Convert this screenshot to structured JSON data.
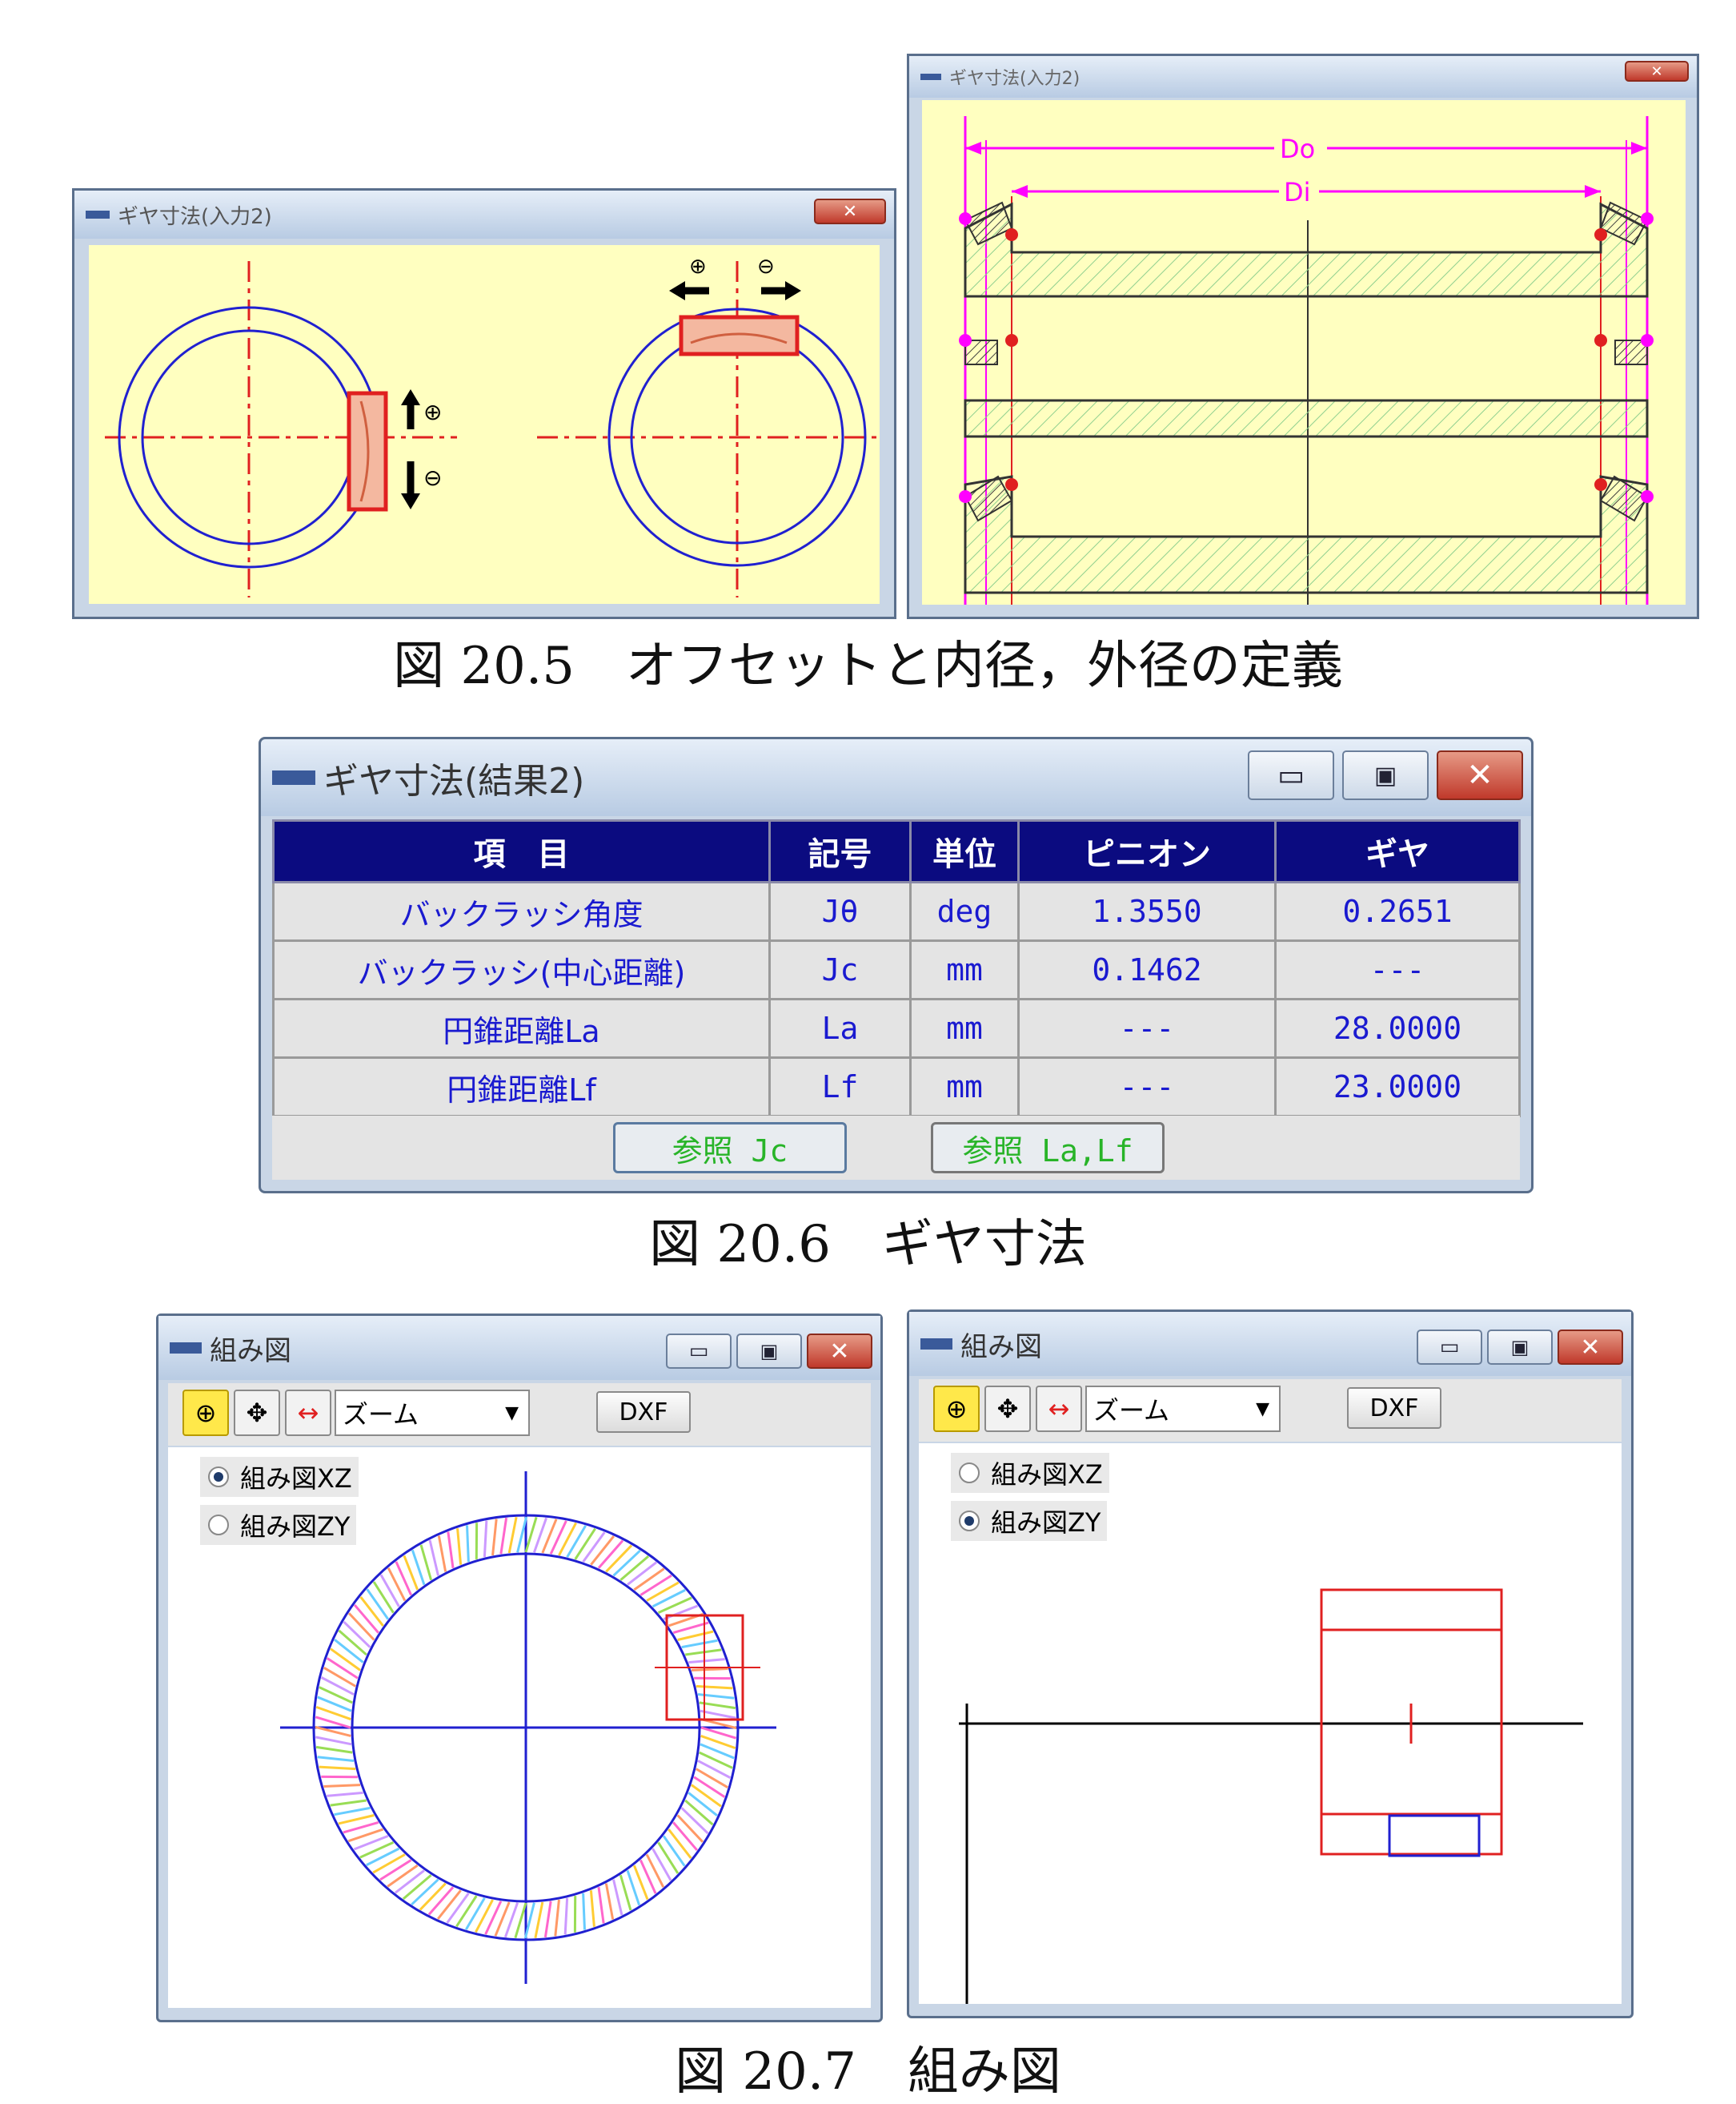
{
  "fig205": {
    "left_window_title": "ギヤ寸法(入力2)",
    "right_window_title": "ギヤ寸法(入力2)",
    "symbol_plus": "⊕",
    "symbol_minus": "⊖",
    "label_do": "Do",
    "label_di": "Di",
    "caption": "図 20.5　オフセットと内径，外径の定義"
  },
  "fig206": {
    "window_title": "ギヤ寸法(結果2)",
    "columns": [
      "項　目",
      "記号",
      "単位",
      "ピニオン",
      "ギヤ"
    ],
    "rows": [
      [
        "バックラッシ角度",
        "Jθ",
        "deg",
        "1.3550",
        "0.2651"
      ],
      [
        "バックラッシ(中心距離)",
        "Jc",
        "mm",
        "0.1462",
        "---"
      ],
      [
        "円錐距離La",
        "La",
        "mm",
        "---",
        "28.0000"
      ],
      [
        "円錐距離Lf",
        "Lf",
        "mm",
        "---",
        "23.0000"
      ]
    ],
    "button_ref_jc": "参照 Jc",
    "button_ref_la_lf": "参照 La,Lf",
    "caption": "図 20.6　ギヤ寸法"
  },
  "fig207": {
    "left": {
      "window_title": "組み図",
      "zoom_select": "ズーム",
      "dxf_button": "DXF",
      "radio_xz": "組み図XZ",
      "radio_zy": "組み図ZY",
      "selected": "xz"
    },
    "right": {
      "window_title": "組み図",
      "zoom_select": "ズーム",
      "dxf_button": "DXF",
      "radio_xz": "組み図XZ",
      "radio_zy": "組み図ZY",
      "selected": "zy"
    },
    "caption": "図 20.7　組み図"
  },
  "colors": {
    "canvas_yellow": "#ffffc0",
    "header_navy": "#0b0b80",
    "value_blue": "#1a1ad0",
    "button_green": "#28b428",
    "circle_blue": "#2020d0",
    "center_red": "#e02020",
    "dim_magenta": "#ff00ff"
  }
}
